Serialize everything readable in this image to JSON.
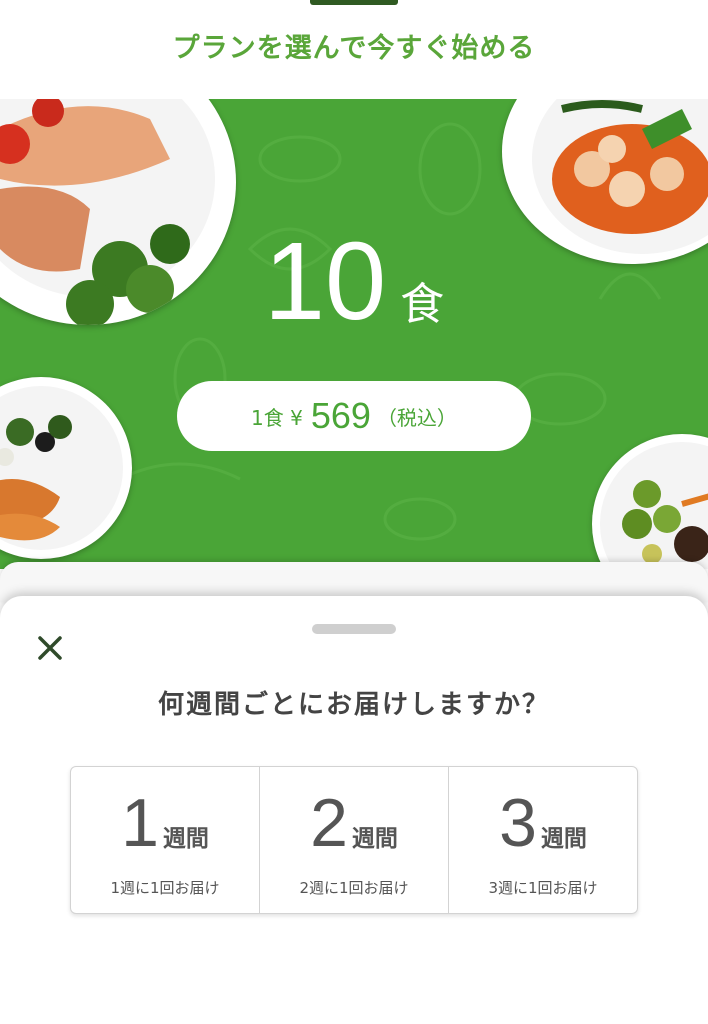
{
  "header": {
    "title": "プランを選んで今すぐ始める"
  },
  "banner": {
    "meals_number": "10",
    "meals_unit": "食",
    "price": {
      "prefix": "1食 ¥",
      "amount": "569",
      "suffix": "（税込）"
    }
  },
  "sheet": {
    "question": "何週間ごとにお届けしますか？",
    "options": [
      {
        "number": "1",
        "unit": "週間",
        "description": "1週に1回お届け"
      },
      {
        "number": "2",
        "unit": "週間",
        "description": "2週に1回お届け"
      },
      {
        "number": "3",
        "unit": "週間",
        "description": "3週に1回お届け"
      }
    ]
  },
  "colors": {
    "brand_green": "#4aa537",
    "title_green": "#5aa63a",
    "close_icon": "#2f4a2a"
  },
  "icons": {
    "close": "close-icon"
  }
}
